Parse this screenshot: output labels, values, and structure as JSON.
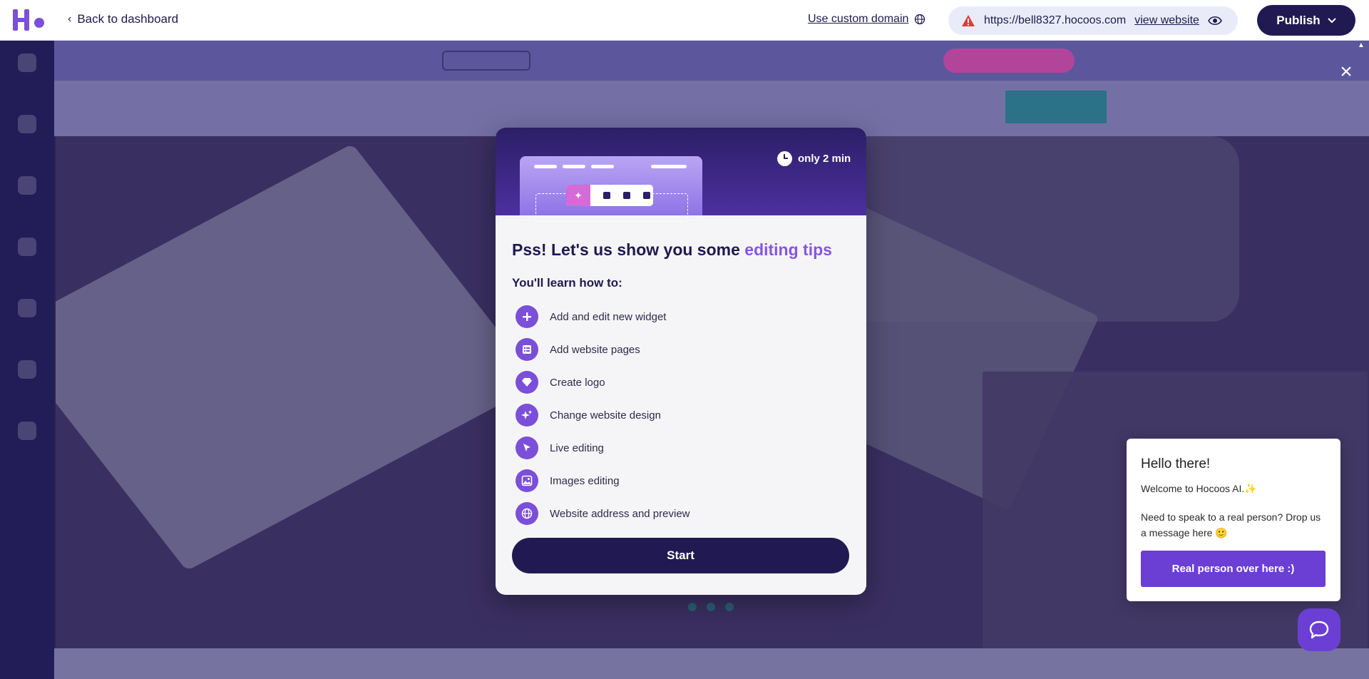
{
  "topbar": {
    "back_label": "Back to dashboard",
    "custom_domain_label": "Use custom domain",
    "site_url": "https://bell8327.hocoos.com",
    "view_website_label": "view website",
    "publish_label": "Publish"
  },
  "modal": {
    "time_label": "only 2 min",
    "title_main": "Pss! Let's us show you some ",
    "title_accent": "editing tips",
    "subtitle": "You'll learn how to:",
    "tips": [
      {
        "icon": "plus-icon",
        "label": "Add and edit new widget"
      },
      {
        "icon": "pages-icon",
        "label": "Add website pages"
      },
      {
        "icon": "diamond-icon",
        "label": "Create logo"
      },
      {
        "icon": "sparkle-icon",
        "label": "Change website design"
      },
      {
        "icon": "cursor-icon",
        "label": "Live editing"
      },
      {
        "icon": "image-icon",
        "label": "Images editing"
      },
      {
        "icon": "globe-icon",
        "label": "Website address and preview"
      }
    ],
    "start_label": "Start"
  },
  "chat": {
    "greeting": "Hello there!",
    "welcome": "Welcome to Hocoos AI.✨",
    "message": "Need to speak to a real person? Drop us a message here 🙂",
    "button_label": "Real person over here :)"
  },
  "colors": {
    "brand_dark": "#211a52",
    "accent_purple": "#8656e0",
    "chat_purple": "#6b3fd4",
    "warning_red": "#e03a3a"
  }
}
